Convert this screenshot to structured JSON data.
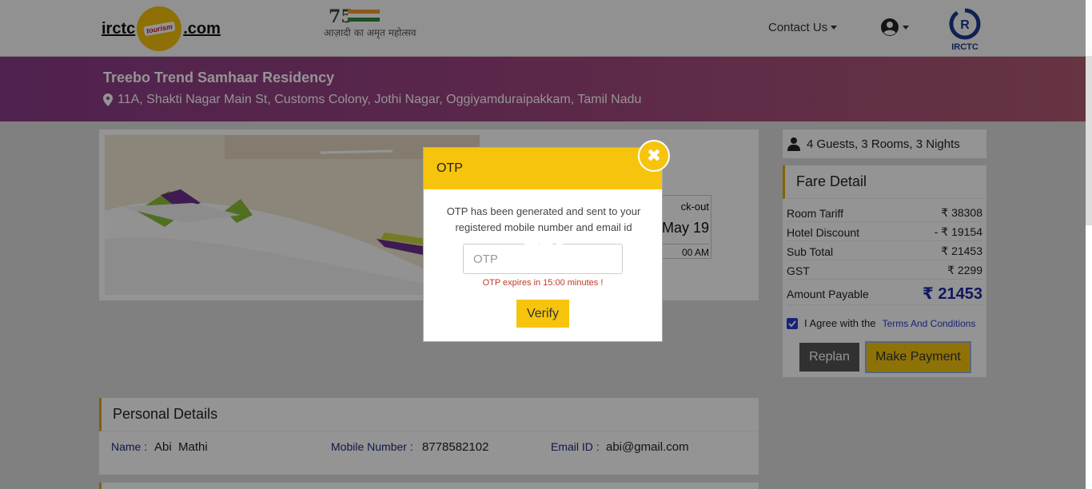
{
  "header": {
    "logo_left": "irctc",
    "logo_right": ".com",
    "logo_badge": "tourism",
    "azadi_number": "75",
    "azadi_text": "आज़ादी का अमृत महोत्सव",
    "contact_label": "Contact Us",
    "irctc_text": "IRCTC",
    "irctc_mark": "R"
  },
  "hotel": {
    "name": "Treebo Trend Samhaar Residency",
    "address": "11A, Shakti Nagar Main St, Customs Colony, Jothi Nagar, Oggiyamduraipakkam, Tamil Nadu"
  },
  "stay": {
    "checkout_label": "ck-out",
    "checkout_date": "May 19",
    "checkout_time": "00 AM"
  },
  "guests": {
    "summary": "4 Guests, 3 Rooms, 3 Nights"
  },
  "fare": {
    "title": "Fare Detail",
    "rows": [
      {
        "label": "Room Tariff",
        "value": "₹ 38308"
      },
      {
        "label": "Hotel Discount",
        "value": "- ₹ 19154"
      },
      {
        "label": "Sub Total",
        "value": "₹ 21453"
      },
      {
        "label": "GST",
        "value": "₹ 2299"
      },
      {
        "label": "Amount Payable",
        "value": "₹ 21453"
      }
    ],
    "agree_text": "I Agree with the",
    "terms_link": "Terms And Conditions",
    "agree_checked": true,
    "replan_label": "Replan",
    "pay_label": "Make Payment"
  },
  "personal": {
    "title": "Personal Details",
    "name_label": "Name :",
    "name_value": "Abi  Mathi",
    "mobile_label": "Mobile Number :",
    "mobile_value": "8778582102",
    "email_label": "Email ID :",
    "email_value": "abi@gmail.com"
  },
  "otp_modal": {
    "title": "OTP",
    "close_symbol": "✖",
    "message": "OTP has been generated and sent to your registered mobile number and email id",
    "input_placeholder": "OTP",
    "input_value": "",
    "expiry_text": "OTP expires in 15:00 minutes !",
    "verify_label": "Verify"
  },
  "colors": {
    "accent_yellow": "#f7c40d",
    "banner_purple": "#8a3b88",
    "link_blue": "#2b3bd3",
    "amount_blue": "#1f2aa0",
    "error_red": "#c0392b"
  },
  "icons": [
    "user-circle-icon",
    "map-marker-icon",
    "users-icon",
    "close-icon",
    "check-icon",
    "caret-down-icon"
  ]
}
